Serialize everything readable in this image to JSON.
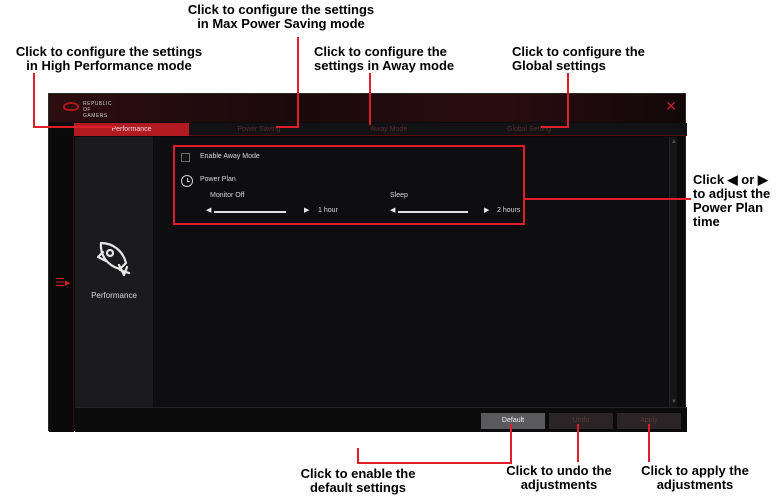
{
  "callouts": {
    "max_power_saving": [
      "Click to configure the settings",
      "in Max Power Saving mode"
    ],
    "high_performance": [
      "Click to configure the settings",
      "in High Performance mode"
    ],
    "away_mode": [
      "Click to configure the",
      "settings in Away mode"
    ],
    "global": [
      "Click to configure the",
      "Global settings"
    ],
    "adjust_time": [
      "Click ◀ or ▶",
      "to adjust the",
      "Power Plan",
      "time"
    ],
    "default": [
      "Click to enable the",
      "default settings"
    ],
    "undo": [
      "Click to undo the",
      "adjustments"
    ],
    "apply": [
      "Click to apply the",
      "adjustments"
    ]
  },
  "app": {
    "logo_text": [
      "REPUBLIC OF",
      "GAMERS"
    ],
    "close_icon": "✕",
    "tabs": [
      {
        "label": "Performance",
        "active": true
      },
      {
        "label": "Power Saving",
        "active": false
      },
      {
        "label": "Away Mode",
        "active": false
      },
      {
        "label": "Global Setting",
        "active": false
      }
    ],
    "side_label": "Performance",
    "enable_away_mode": "Enable Away Mode",
    "power_plan": "Power Plan",
    "monitor_off": {
      "label": "Monitor Off",
      "value": "1 hour"
    },
    "sleep": {
      "label": "Sleep",
      "value": "2 hours"
    },
    "buttons": {
      "default": "Default",
      "undo": "Undo",
      "apply": "Apply"
    },
    "menu_icon": "☰▸"
  },
  "colors": {
    "accent": "#e11d2a",
    "tab_active": "#b21a22"
  }
}
